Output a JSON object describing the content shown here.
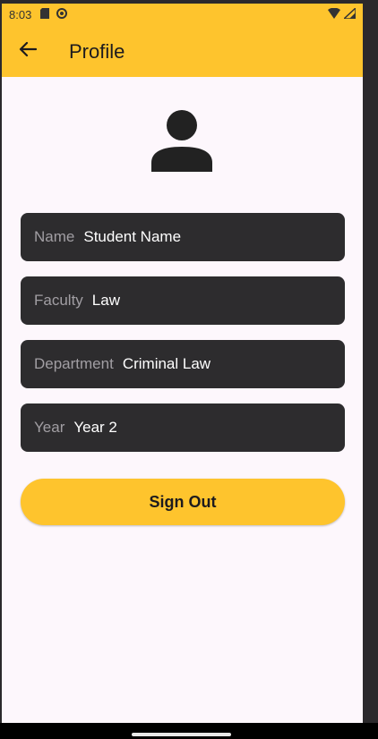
{
  "status_bar": {
    "time": "8:03",
    "left_icons": [
      "sd-card-icon",
      "sync-icon"
    ],
    "right_icons": [
      "wifi-icon",
      "signal-icon"
    ]
  },
  "app_bar": {
    "back_icon": "arrow-left-icon",
    "title": "Profile"
  },
  "profile": {
    "avatar_icon": "person-icon",
    "fields": [
      {
        "label": "Name",
        "value": "Student Name"
      },
      {
        "label": "Faculty",
        "value": "Law"
      },
      {
        "label": "Department",
        "value": "Criminal Law"
      },
      {
        "label": "Year",
        "value": "Year 2"
      }
    ]
  },
  "actions": {
    "sign_out_label": "Sign Out"
  },
  "colors": {
    "accent": "#fec42d",
    "field_background": "#2d2c2e",
    "page_background": "#fdf7fc"
  }
}
